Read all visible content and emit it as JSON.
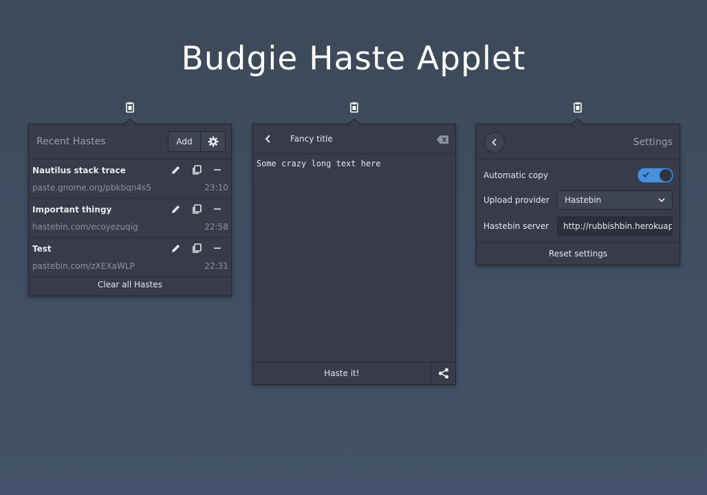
{
  "app": {
    "title": "Budgie Haste Applet"
  },
  "tray": {
    "icon": "clipboard-icon"
  },
  "recent": {
    "title": "Recent Hastes",
    "add_label": "Add",
    "items": [
      {
        "title": "Nautilus stack trace",
        "url": "paste.gnome.org/pbkbqn4s5",
        "time": "23:10"
      },
      {
        "title": "Important thingy",
        "url": "hastebin.com/ecoyezuqig",
        "time": "22:58"
      },
      {
        "title": "Test",
        "url": "pastebin.com/zXEXaWLP",
        "time": "22:31"
      }
    ],
    "clear_label": "Clear all Hastes"
  },
  "editor": {
    "title": "Fancy title",
    "text": "Some crazy long text here",
    "haste_label": "Haste it!"
  },
  "settings": {
    "title": "Settings",
    "auto_copy_label": "Automatic copy",
    "auto_copy": true,
    "provider_label": "Upload provider",
    "provider_value": "Hastebin",
    "server_label": "Hastebin server",
    "server_value": "http://rubbishbin.herokuapp.com",
    "reset_label": "Reset settings"
  },
  "colors": {
    "accent": "#4a90d9",
    "popover": "#373b4a",
    "background": "#3f4c5d"
  }
}
